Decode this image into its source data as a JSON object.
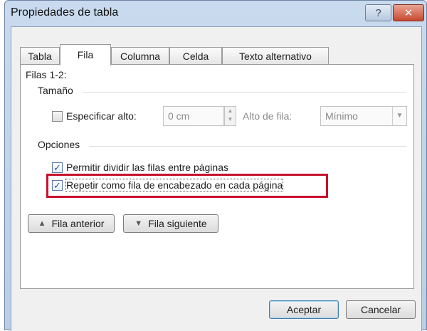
{
  "window": {
    "title": "Propiedades de tabla",
    "help_glyph": "?",
    "close_glyph": "✕"
  },
  "tabs": [
    {
      "label": "Tabla"
    },
    {
      "label": "Fila"
    },
    {
      "label": "Columna"
    },
    {
      "label": "Celda"
    },
    {
      "label": "Texto alternativo"
    }
  ],
  "active_tab": "Fila",
  "panel": {
    "rows_label": "Filas 1-2:",
    "size_group": "Tamaño",
    "specify_height_label": "Especificar alto:",
    "specify_height_checked": false,
    "height_value": "0 cm",
    "row_height_label": "Alto de fila:",
    "row_height_mode": "Mínimo",
    "options_group": "Opciones",
    "allow_break_label": "Permitir dividir las filas entre páginas",
    "allow_break_checked": true,
    "repeat_header_label": "Repetir como fila de encabezado en cada página",
    "repeat_header_checked": true,
    "check_glyph": "✓",
    "prev_row_label": "Fila anterior",
    "next_row_label": "Fila siguiente",
    "up_glyph": "▲",
    "down_glyph": "▼"
  },
  "buttons": {
    "ok": "Aceptar",
    "cancel": "Cancelar"
  },
  "colors": {
    "highlight": "#c8102e",
    "check": "#2a56a8",
    "title_bar": "#c9daee"
  }
}
